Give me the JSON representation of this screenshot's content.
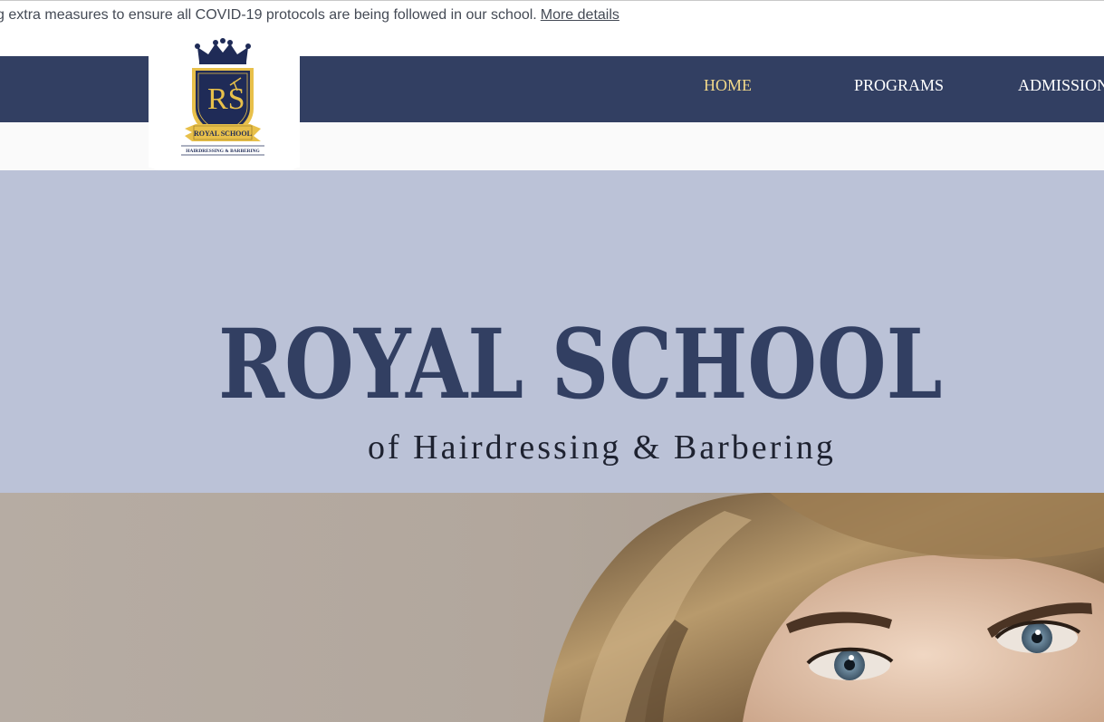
{
  "announcement": {
    "text": "g extra measures to ensure all COVID-19 protocols are being followed in our school.",
    "link": "More details"
  },
  "logo": {
    "monogram": "RS",
    "banner": "ROYAL SCHOOL",
    "tagline": "HAIRDRESSING & BARBERING"
  },
  "nav": {
    "items": [
      {
        "label": "HOME",
        "active": true
      },
      {
        "label": "PROGRAMS",
        "active": false
      },
      {
        "label": "ADMISSIONS",
        "active": false
      }
    ]
  },
  "hero": {
    "title": "ROYAL SCHOOL",
    "subtitle": "of Hairdressing & Barbering"
  },
  "colors": {
    "navy": "#323f62",
    "nav_active": "#f1d88a",
    "hero_band": "#bbc2d7",
    "gold": "#e8c04a"
  }
}
